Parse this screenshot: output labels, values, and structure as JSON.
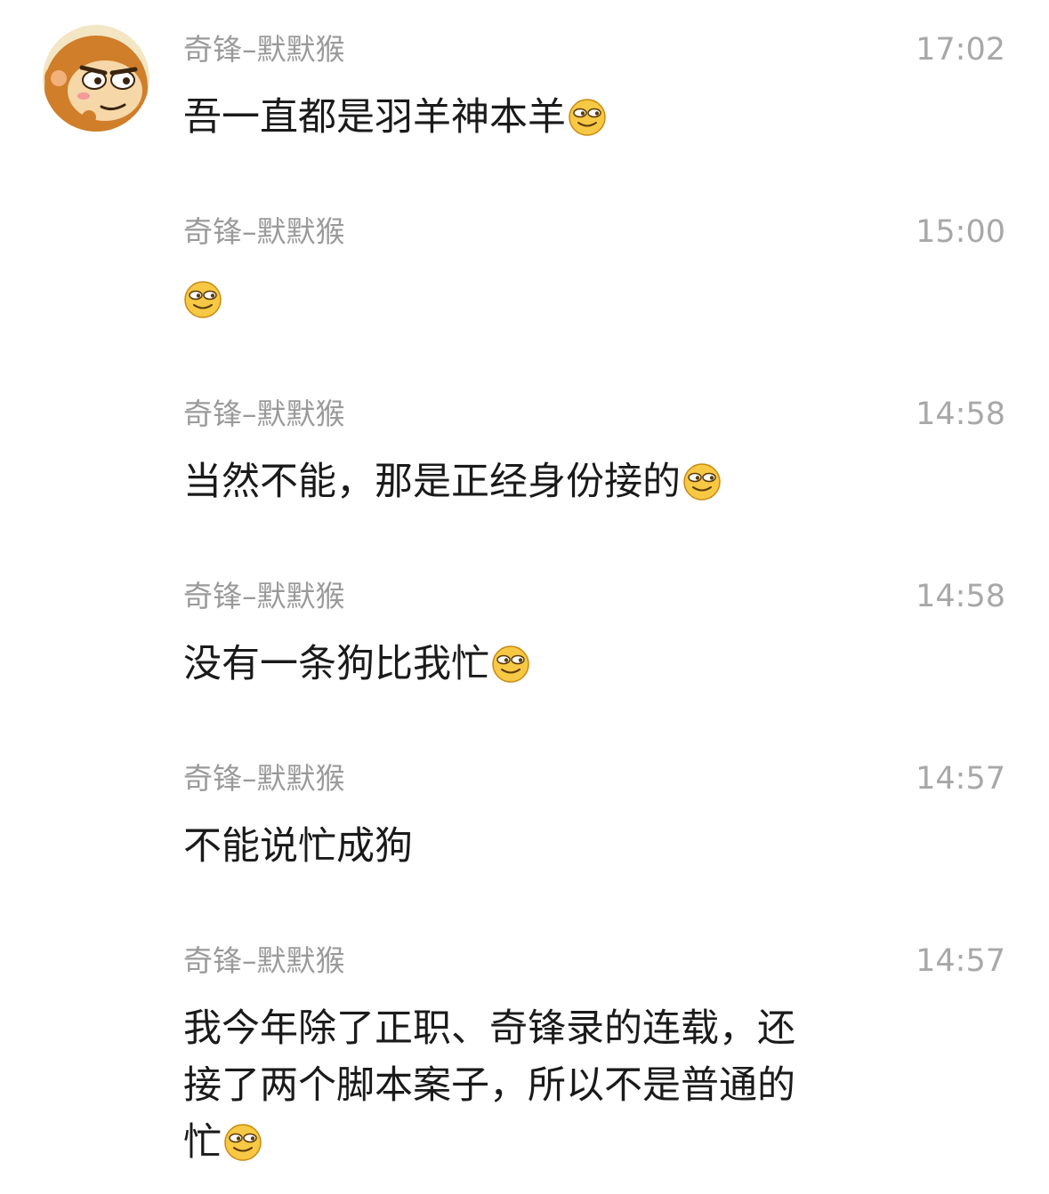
{
  "chat": {
    "messages": [
      {
        "sender": "奇锋–默默猴",
        "time": "17:02",
        "text": "吾一直都是羽羊神本羊",
        "emoji": "smirk-emoji"
      },
      {
        "sender": "奇锋–默默猴",
        "time": "15:00",
        "text": "",
        "emoji": "smirk-emoji"
      },
      {
        "sender": "奇锋–默默猴",
        "time": "14:58",
        "text": "当然不能，那是正经身份接的",
        "emoji": "smirk-emoji"
      },
      {
        "sender": "奇锋–默默猴",
        "time": "14:58",
        "text": "没有一条狗比我忙",
        "emoji": "smirk-emoji"
      },
      {
        "sender": "奇锋–默默猴",
        "time": "14:57",
        "text": "不能说忙成狗",
        "emoji": ""
      },
      {
        "sender": "奇锋–默默猴",
        "time": "14:57",
        "text": "我今年除了正职、奇锋录的连载，还接了两个脚本案子，所以不是普通的忙",
        "emoji": "smirk-emoji"
      }
    ]
  },
  "colors": {
    "sender": "#9a9a9a",
    "time": "#a8a8a8",
    "text": "#1a1a1a",
    "emoji_face": "#f7c843",
    "avatar_fur": "#c9772a"
  }
}
